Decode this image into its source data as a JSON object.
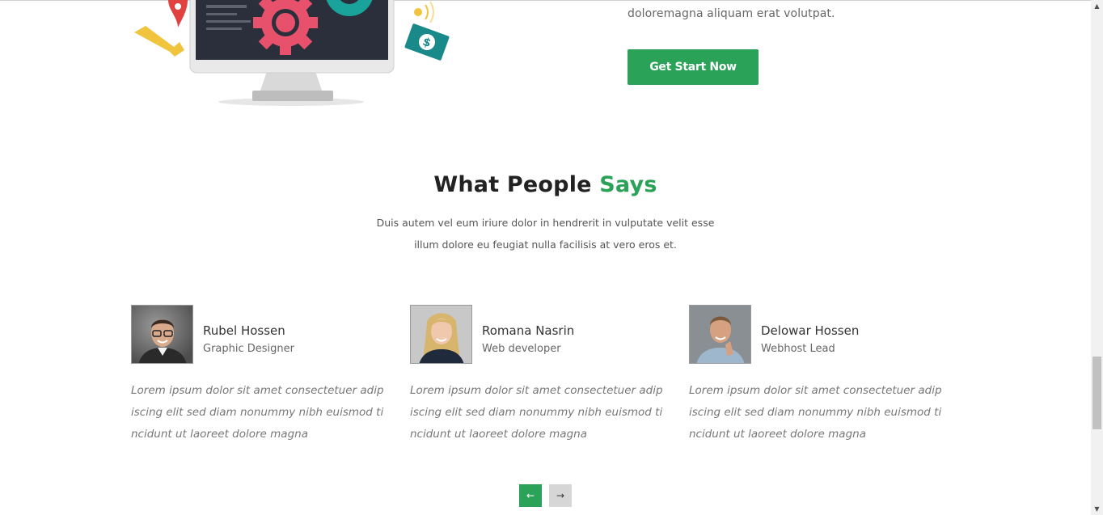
{
  "hero": {
    "text": "doloremagna aliquam erat volutpat.",
    "cta_label": "Get Start Now"
  },
  "testimonials": {
    "title_main": "What People",
    "title_accent": "Says",
    "subtitle_line1": "Duis autem vel eum iriure dolor in hendrerit in vulputate velit esse",
    "subtitle_line2": "illum dolore eu feugiat nulla facilisis at vero eros et.",
    "items": [
      {
        "name": "Rubel Hossen",
        "role": "Graphic Designer",
        "quote_lines": [
          "Lorem ipsum dolor sit amet consectetuer adip",
          "iscing elit sed diam nonummy nibh euismod ti",
          "ncidunt ut laoreet dolore magna"
        ]
      },
      {
        "name": "Romana Nasrin",
        "role": "Web developer",
        "quote_lines": [
          "Lorem ipsum dolor sit amet consectetuer adip",
          "iscing elit sed diam nonummy nibh euismod ti",
          "ncidunt ut laoreet dolore magna"
        ]
      },
      {
        "name": "Delowar Hossen",
        "role": "Webhost Lead",
        "quote_lines": [
          "Lorem ipsum dolor sit amet consectetuer adip",
          "iscing elit sed diam nonummy nibh euismod ti",
          "ncidunt ut laoreet dolore magna"
        ]
      }
    ],
    "prev_icon": "←",
    "next_icon": "→"
  },
  "colors": {
    "accent": "#2aa257",
    "nav_inactive": "#d6d6d6"
  },
  "icons": {
    "illustration": "monitor-gears-illustration",
    "prev": "arrow-left-icon",
    "next": "arrow-right-icon"
  }
}
